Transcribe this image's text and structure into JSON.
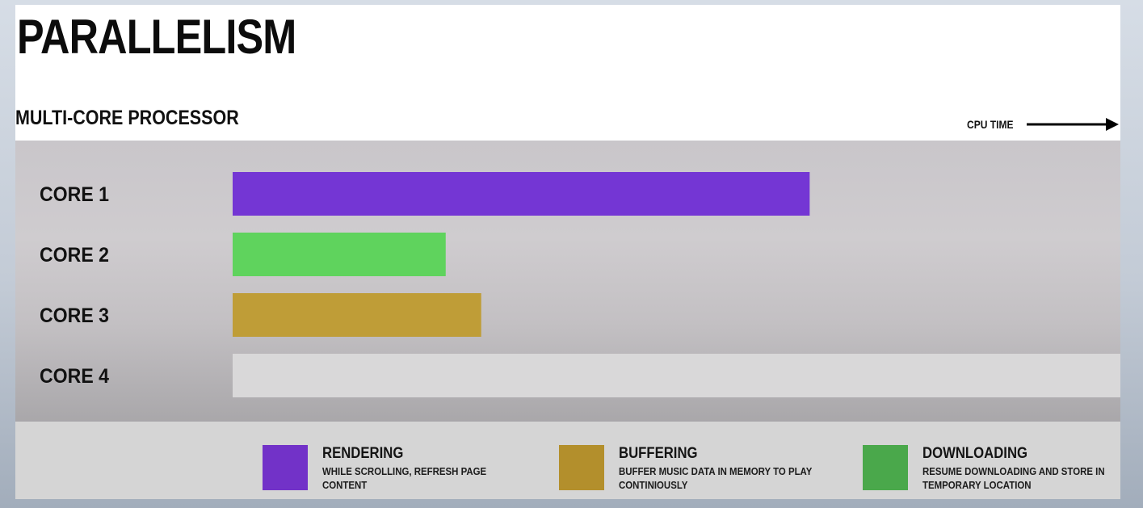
{
  "title": "PARALLELISM",
  "subtitle": "MULTI-CORE PROCESSOR",
  "axis_label": "CPU TIME",
  "colors": {
    "rendering": "#7436d4",
    "downloading": "#5fd35d",
    "buffering": "#bf9d37",
    "idle": "#d9d8d9",
    "legend_downloading": "#4aa84b",
    "legend_buffering": "#b38f2c",
    "legend_rendering": "#7232c8"
  },
  "chart_data": {
    "type": "bar",
    "orientation": "horizontal",
    "x_label": "CPU TIME",
    "categories": [
      "CORE 1",
      "CORE 2",
      "CORE 3",
      "CORE 4"
    ],
    "values": [
      0.65,
      0.24,
      0.28,
      1.0
    ],
    "value_units": "fraction of visible CPU time axis",
    "bar_task": [
      "rendering",
      "downloading",
      "buffering",
      "idle"
    ],
    "xlim": [
      0,
      1
    ]
  },
  "legend": [
    {
      "key": "rendering",
      "name": "RENDERING",
      "description": "WHILE SCROLLING, REFRESH PAGE CONTENT"
    },
    {
      "key": "buffering",
      "name": "BUFFERING",
      "description": "BUFFER MUSIC DATA IN MEMORY TO PLAY CONTINIOUSLY"
    },
    {
      "key": "downloading",
      "name": "DOWNLOADING",
      "description": "RESUME DOWNLOADING AND STORE IN TEMPORARY LOCATION"
    }
  ]
}
